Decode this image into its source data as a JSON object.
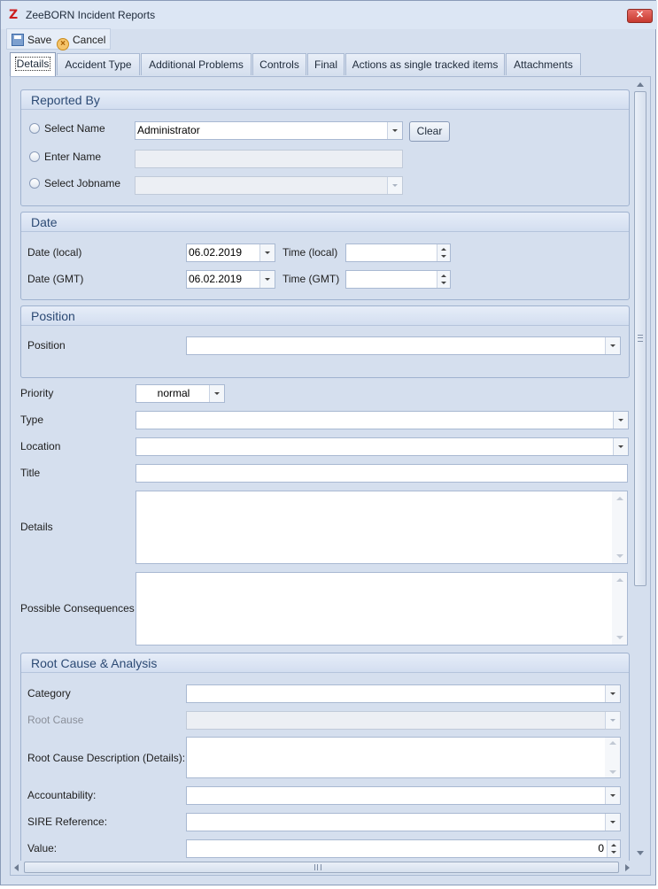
{
  "window": {
    "title": "ZeeBORN Incident Reports",
    "app_icon": "Z",
    "close_label": "✕"
  },
  "toolbar": {
    "save_label": "Save",
    "cancel_label": "Cancel"
  },
  "tabs": [
    {
      "label": "Details",
      "active": true
    },
    {
      "label": "Accident Type"
    },
    {
      "label": "Additional Problems"
    },
    {
      "label": "Controls"
    },
    {
      "label": "Final"
    },
    {
      "label": "Actions as single tracked items"
    },
    {
      "label": "Attachments"
    }
  ],
  "reported_by": {
    "header": "Reported By",
    "select_name_label": "Select Name",
    "select_name_value": "Administrator",
    "clear_label": "Clear",
    "enter_name_label": "Enter Name",
    "enter_name_value": "",
    "select_jobname_label": "Select Jobname",
    "select_jobname_value": ""
  },
  "date": {
    "header": "Date",
    "date_local_label": "Date (local)",
    "date_local_value": "06.02.2019",
    "time_local_label": "Time (local)",
    "time_local_value": "",
    "date_gmt_label": "Date (GMT)",
    "date_gmt_value": "06.02.2019",
    "time_gmt_label": "Time (GMT)",
    "time_gmt_value": ""
  },
  "position": {
    "header": "Position",
    "label": "Position",
    "value": ""
  },
  "fields": {
    "priority_label": "Priority",
    "priority_value": "normal",
    "type_label": "Type",
    "type_value": "",
    "location_label": "Location",
    "location_value": "",
    "title_label": "Title",
    "title_value": "",
    "details_label": "Details",
    "details_value": "",
    "consequences_label": "Possible Consequences",
    "consequences_value": ""
  },
  "root_cause": {
    "header": "Root Cause & Analysis",
    "category_label": "Category",
    "category_value": "",
    "root_cause_label": "Root Cause",
    "root_cause_value": "",
    "description_label": "Root Cause Description (Details):",
    "description_value": "",
    "accountability_label": "Accountability:",
    "accountability_value": "",
    "sire_label": "SIRE Reference:",
    "sire_value": "",
    "value_label": "Value:",
    "value_value": "0"
  }
}
